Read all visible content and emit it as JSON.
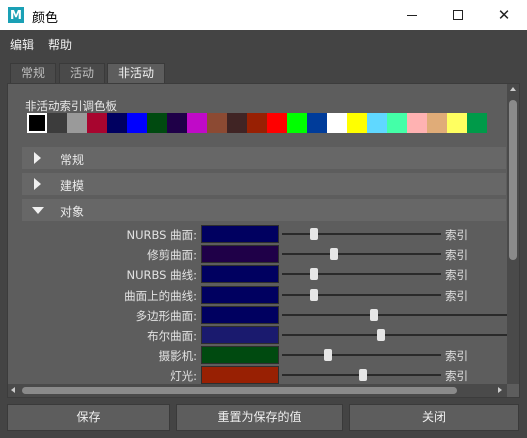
{
  "window": {
    "app_icon_letter": "M",
    "title": "颜色",
    "minimize_icon": "minimize-icon",
    "maximize_icon": "maximize-icon",
    "close_icon": "close-icon",
    "close_glyph": "✕"
  },
  "menubar": {
    "items": [
      "编辑",
      "帮助"
    ]
  },
  "tabs": [
    {
      "label": "常规",
      "active": false
    },
    {
      "label": "活动",
      "active": false
    },
    {
      "label": "非活动",
      "active": true
    }
  ],
  "palette": {
    "label": "非活动索引调色板",
    "swatches": [
      "#000000",
      "#3c3c3c",
      "#9a9a9a",
      "#a8052f",
      "#000060",
      "#0000ff",
      "#004a10",
      "#1f0048",
      "#c00ac8",
      "#8c4a33",
      "#402424",
      "#982003",
      "#ff0000",
      "#00ff00",
      "#003c9a",
      "#ffffff",
      "#ffff00",
      "#60d8ff",
      "#44ffa8",
      "#ffb2b2",
      "#e0ac78",
      "#ffff60",
      "#009a49"
    ],
    "selected_index": 0
  },
  "sections": [
    {
      "label": "常规",
      "expanded": false
    },
    {
      "label": "建模",
      "expanded": false
    },
    {
      "label": "对象",
      "expanded": true
    }
  ],
  "attributes": [
    {
      "label": "NURBS 曲面:",
      "color": "#000060",
      "slider": 0.2,
      "index_label": "索引"
    },
    {
      "label": "修剪曲面:",
      "color": "#1f0048",
      "slider": 0.33,
      "index_label": "索引"
    },
    {
      "label": "NURBS 曲线:",
      "color": "#000060",
      "slider": 0.2,
      "index_label": "索引"
    },
    {
      "label": "曲面上的曲线:",
      "color": "#000060",
      "slider": 0.2,
      "index_label": "索引"
    },
    {
      "label": "多边形曲面:",
      "color": "#000060",
      "slider": 0.41,
      "index_label": ""
    },
    {
      "label": "布尔曲面:",
      "color": "#1a1a6e",
      "slider": 0.44,
      "index_label": ""
    },
    {
      "label": "摄影机:",
      "color": "#004a10",
      "slider": 0.29,
      "index_label": "索引"
    },
    {
      "label": "灯光:",
      "color": "#982003",
      "slider": 0.51,
      "index_label": "索引"
    }
  ],
  "buttons": {
    "save": "保存",
    "reset": "重置为保存的值",
    "close": "关闭"
  }
}
